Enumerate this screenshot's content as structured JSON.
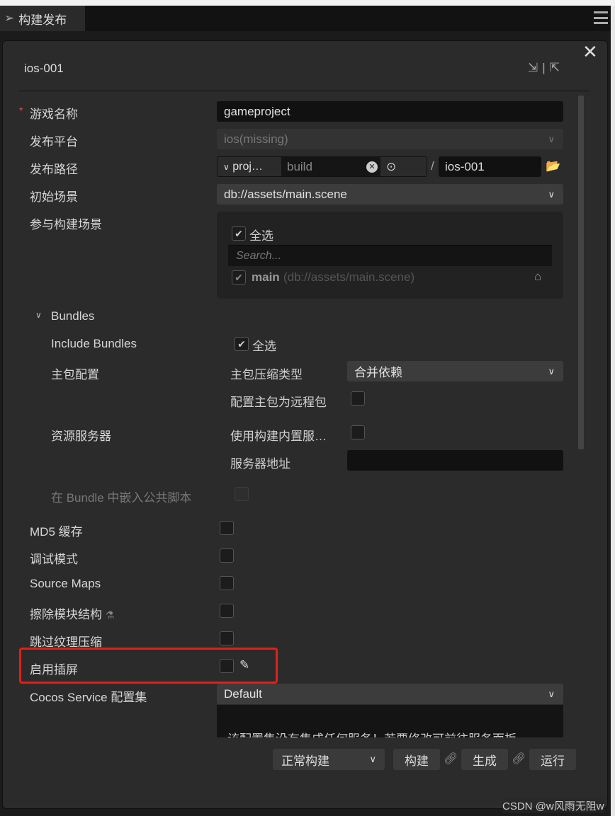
{
  "tab": {
    "title": "构建发布",
    "icon": "paper-plane-icon"
  },
  "dialog": {
    "title": "ios-001"
  },
  "fields": {
    "game_name": {
      "label": "游戏名称",
      "required": "*",
      "value": "gameproject"
    },
    "platform": {
      "label": "发布平台",
      "value": "ios(missing)"
    },
    "path": {
      "label": "发布路径",
      "prefix": "proj…",
      "dir": "build",
      "sep": "/",
      "name": "ios-001"
    },
    "start_scene": {
      "label": "初始场景",
      "value": "db://assets/main.scene"
    },
    "scenes": {
      "label": "参与构建场景",
      "select_all": "全选",
      "search_placeholder": "Search...",
      "item_name": "main",
      "item_path": "(db://assets/main.scene)"
    }
  },
  "bundles": {
    "header": "Bundles",
    "include_label": "Include Bundles",
    "include_all": "全选",
    "main_config": "主包配置",
    "compress_label": "主包压缩类型",
    "compress_value": "合并依赖",
    "remote_label": "配置主包为远程包",
    "server_label": "资源服务器",
    "builtin_server": "使用构建内置服…",
    "server_addr": "服务器地址",
    "embed_label": "在 Bundle 中嵌入公共脚本"
  },
  "options": [
    {
      "label": "MD5 缓存"
    },
    {
      "label": "调试模式"
    },
    {
      "label": "Source Maps"
    },
    {
      "label": "擦除模块结构"
    },
    {
      "label": "跳过纹理压缩"
    },
    {
      "label": "启用插屏"
    }
  ],
  "cocos": {
    "label": "Cocos Service 配置集",
    "value": "Default",
    "desc": "该配置集没有集成任何服务！若要修改可前往服务面板"
  },
  "footer": {
    "mode": "正常构建",
    "build": "构建",
    "make": "生成",
    "run": "运行"
  },
  "watermark": "CSDN @w风雨无阻w",
  "highlight_color": "#e0201a"
}
